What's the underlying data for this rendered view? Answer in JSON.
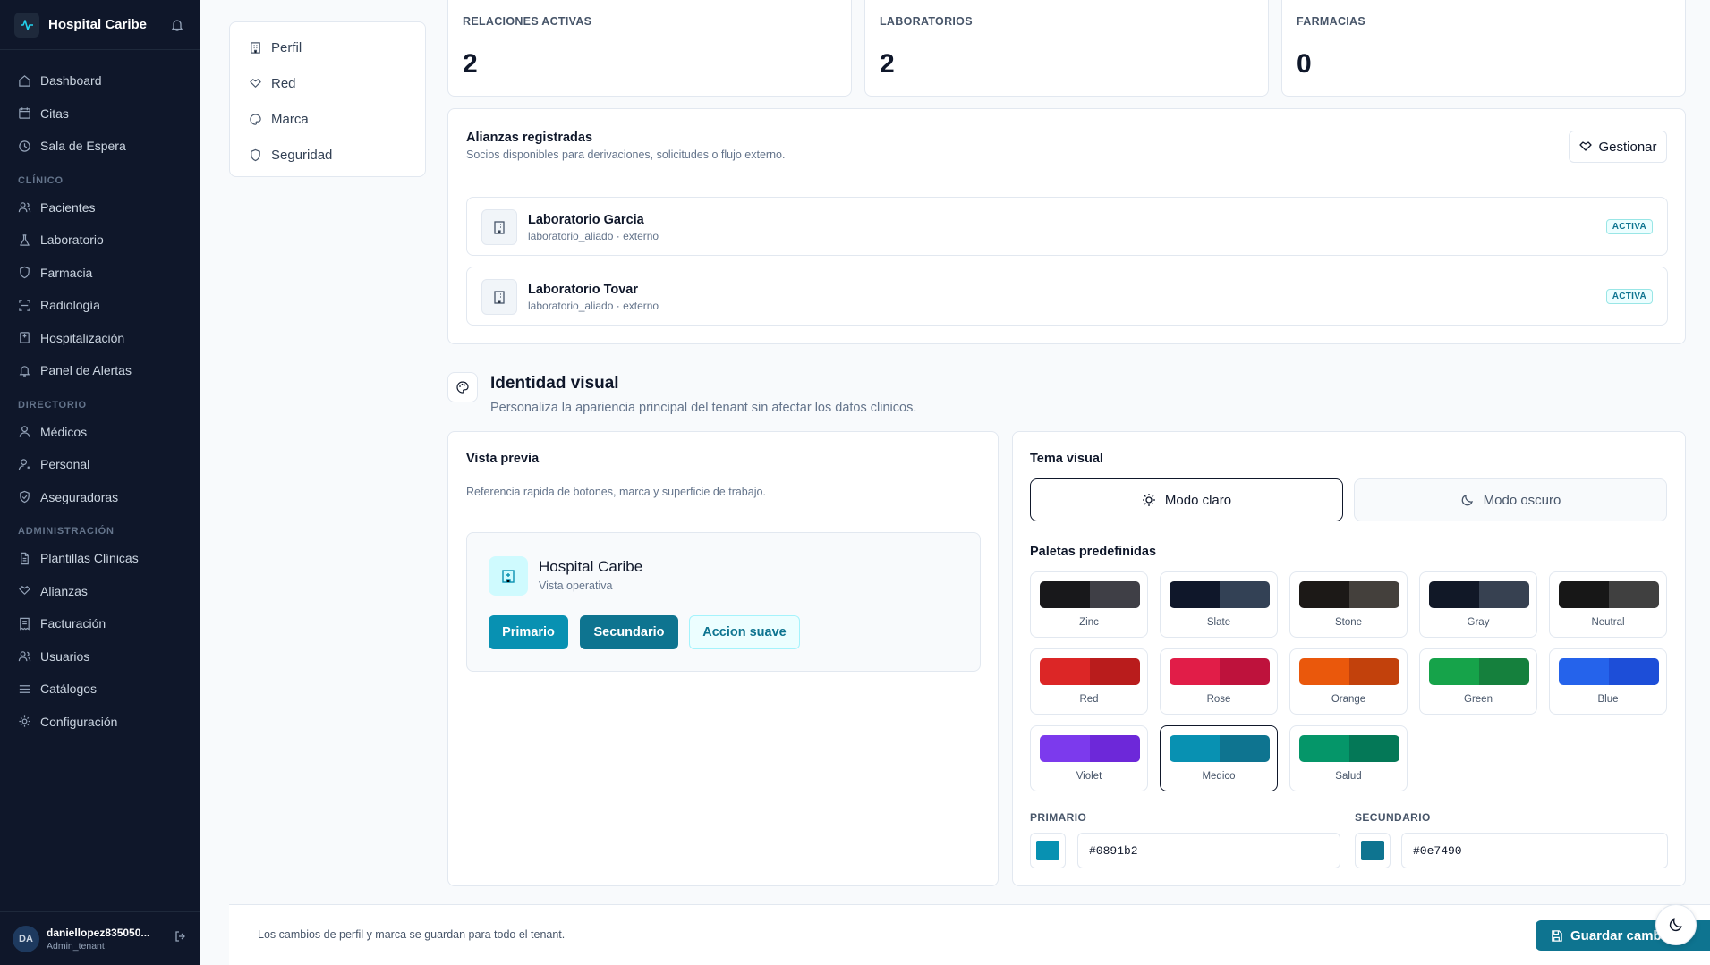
{
  "app": {
    "name": "Hospital Caribe"
  },
  "sidebar": {
    "top_items": [
      {
        "label": "Dashboard",
        "icon": "home-icon"
      },
      {
        "label": "Citas",
        "icon": "calendar-icon"
      },
      {
        "label": "Sala de Espera",
        "icon": "clock-icon"
      }
    ],
    "sections": [
      {
        "title": "CLÍNICO",
        "items": [
          {
            "label": "Pacientes",
            "icon": "users-icon"
          },
          {
            "label": "Laboratorio",
            "icon": "flask-icon"
          },
          {
            "label": "Farmacia",
            "icon": "shield-icon"
          },
          {
            "label": "Radiología",
            "icon": "scan-icon"
          },
          {
            "label": "Hospitalización",
            "icon": "bed-icon"
          },
          {
            "label": "Panel de Alertas",
            "icon": "bell-icon"
          }
        ]
      },
      {
        "title": "DIRECTORIO",
        "items": [
          {
            "label": "Médicos",
            "icon": "user-icon"
          },
          {
            "label": "Personal",
            "icon": "user-cog-icon"
          },
          {
            "label": "Aseguradoras",
            "icon": "shield-check-icon"
          }
        ]
      },
      {
        "title": "ADMINISTRACIÓN",
        "items": [
          {
            "label": "Plantillas Clínicas",
            "icon": "file-icon"
          },
          {
            "label": "Alianzas",
            "icon": "handshake-icon"
          },
          {
            "label": "Facturación",
            "icon": "receipt-icon"
          },
          {
            "label": "Usuarios",
            "icon": "users-icon"
          },
          {
            "label": "Catálogos",
            "icon": "list-icon"
          },
          {
            "label": "Configuración",
            "icon": "gear-icon"
          }
        ]
      }
    ],
    "user": {
      "initials": "DA",
      "name": "daniellopez835050...",
      "role": "Admin_tenant"
    }
  },
  "settings_menu": [
    {
      "label": "Perfil",
      "icon": "building-icon"
    },
    {
      "label": "Red",
      "icon": "handshake-icon"
    },
    {
      "label": "Marca",
      "icon": "palette-icon"
    },
    {
      "label": "Seguridad",
      "icon": "shield-icon"
    }
  ],
  "stats": [
    {
      "label": "RELACIONES ACTIVAS",
      "value": "2"
    },
    {
      "label": "LABORATORIOS",
      "value": "2"
    },
    {
      "label": "FARMACIAS",
      "value": "0"
    }
  ],
  "alliances": {
    "title": "Alianzas registradas",
    "subtitle": "Socios disponibles para derivaciones, solicitudes o flujo externo.",
    "manage_label": "Gestionar",
    "items": [
      {
        "name": "Laboratorio Garcia",
        "meta": "laboratorio_aliado · externo",
        "status": "ACTIVA"
      },
      {
        "name": "Laboratorio Tovar",
        "meta": "laboratorio_aliado · externo",
        "status": "ACTIVA"
      }
    ]
  },
  "identity": {
    "title": "Identidad visual",
    "subtitle": "Personaliza la apariencia principal del tenant sin afectar los datos clinicos."
  },
  "preview": {
    "title": "Vista previa",
    "subtitle": "Referencia rapida de botones, marca y superficie de trabajo.",
    "brand_name": "Hospital Caribe",
    "brand_sub": "Vista operativa",
    "primary_btn": "Primario",
    "secondary_btn": "Secundario",
    "soft_btn": "Accion suave"
  },
  "theme": {
    "title": "Tema visual",
    "light_label": "Modo claro",
    "dark_label": "Modo oscuro",
    "selected_mode": "light",
    "palettes_title": "Paletas predefinidas",
    "palettes": [
      {
        "name": "Zinc",
        "colors": [
          "#18181b",
          "#3f3f46"
        ]
      },
      {
        "name": "Slate",
        "colors": [
          "#0f172a",
          "#334155"
        ]
      },
      {
        "name": "Stone",
        "colors": [
          "#1c1917",
          "#44403c"
        ]
      },
      {
        "name": "Gray",
        "colors": [
          "#111827",
          "#374151"
        ]
      },
      {
        "name": "Neutral",
        "colors": [
          "#171717",
          "#404040"
        ]
      },
      {
        "name": "Red",
        "colors": [
          "#dc2626",
          "#b91c1c"
        ]
      },
      {
        "name": "Rose",
        "colors": [
          "#e11d48",
          "#be123c"
        ]
      },
      {
        "name": "Orange",
        "colors": [
          "#ea580c",
          "#c2410c"
        ]
      },
      {
        "name": "Green",
        "colors": [
          "#16a34a",
          "#15803d"
        ]
      },
      {
        "name": "Blue",
        "colors": [
          "#2563eb",
          "#1d4ed8"
        ]
      },
      {
        "name": "Violet",
        "colors": [
          "#7c3aed",
          "#6d28d9"
        ]
      },
      {
        "name": "Medico",
        "colors": [
          "#0891b2",
          "#0e7490"
        ],
        "selected": true
      },
      {
        "name": "Salud",
        "colors": [
          "#059669",
          "#047857"
        ]
      }
    ],
    "primary_label": "PRIMARIO",
    "primary_value": "#0891b2",
    "secondary_label": "SECUNDARIO",
    "secondary_value": "#0e7490"
  },
  "footer": {
    "note": "Los cambios de perfil y marca se guardan para todo el tenant.",
    "save_label": "Guardar cambios"
  },
  "colors": {
    "sidebar_bg": "#0f172a",
    "primary": "#0891b2",
    "secondary": "#0e7490"
  }
}
